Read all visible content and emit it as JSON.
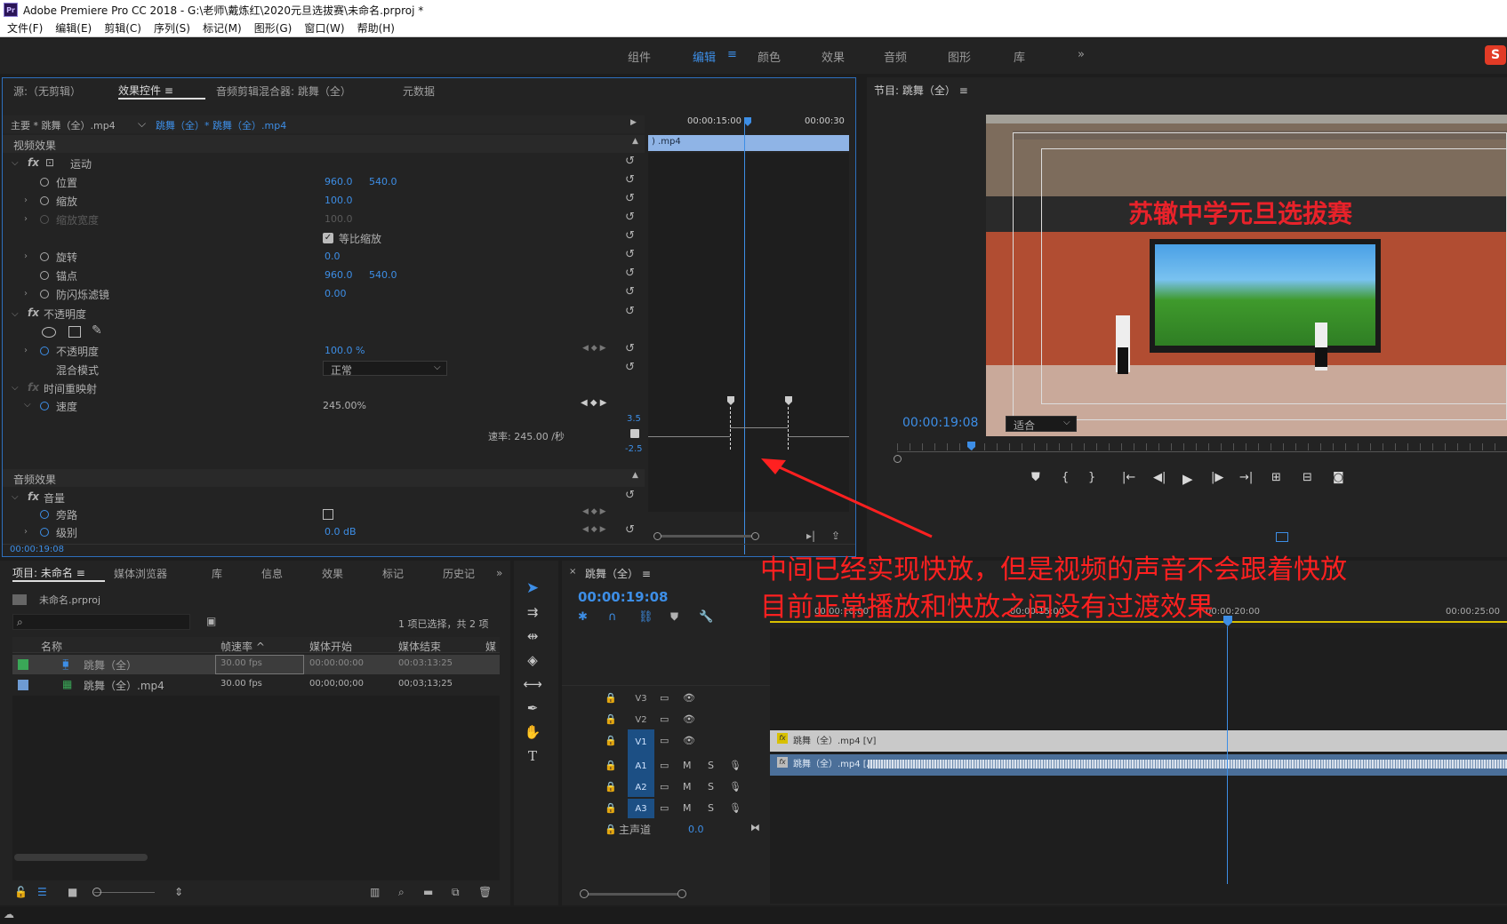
{
  "window": {
    "title": "Adobe Premiere Pro CC 2018 - G:\\老师\\戴炼红\\2020元旦选拔赛\\未命名.prproj *",
    "logo": "Pr"
  },
  "menu": [
    "文件(F)",
    "编辑(E)",
    "剪辑(C)",
    "序列(S)",
    "标记(M)",
    "图形(G)",
    "窗口(W)",
    "帮助(H)"
  ],
  "workspaces": [
    "组件",
    "编辑",
    "颜色",
    "效果",
    "音频",
    "图形",
    "库"
  ],
  "workspace_active": "编辑",
  "effect_panel": {
    "tabs": [
      "源:（无剪辑）",
      "效果控件",
      "音频剪辑混合器: 跳舞（全）",
      "元数据"
    ],
    "master_label": "主要 * 跳舞（全）.mp4",
    "clip_label": "跳舞（全）* 跳舞（全）.mp4",
    "ruler_time1": "00:00:15:00",
    "ruler_time2": "00:00:30",
    "clip_bar": ") .mp4",
    "video_effects": "视频效果",
    "motion": "运动",
    "position": "位置",
    "position_x": "960.0",
    "position_y": "540.0",
    "scale": "缩放",
    "scale_val": "100.0",
    "scale_width": "缩放宽度",
    "scale_width_val": "100.0",
    "uniform_scale": "等比缩放",
    "rotation": "旋转",
    "rotation_val": "0.0",
    "anchor": "锚点",
    "anchor_x": "960.0",
    "anchor_y": "540.0",
    "anti_flicker": "防闪烁滤镜",
    "anti_flicker_val": "0.00",
    "opacity_group": "不透明度",
    "opacity": "不透明度",
    "opacity_val": "100.0 %",
    "blend_mode": "混合模式",
    "blend_val": "正常",
    "time_remap": "时间重映射",
    "speed": "速度",
    "speed_val": "245.00%",
    "speed_max": "3.5",
    "speed_min": "-2.5",
    "rate_label": "速率: 245.00 /秒",
    "audio_effects": "音频效果",
    "volume": "音量",
    "bypass": "旁路",
    "level": "级别",
    "level_val": "0.0 dB",
    "timecode": "00:00:19:08"
  },
  "program": {
    "title": "节目: 跳舞（全）",
    "timecode": "00:00:19:08",
    "fit": "适合",
    "banner": "苏辙中学元旦选拔赛"
  },
  "project": {
    "tabs": [
      "项目: 未命名",
      "媒体浏览器",
      "库",
      "信息",
      "效果",
      "标记",
      "历史记"
    ],
    "file": "未命名.prproj",
    "selection": "1 项已选择，共 2 项",
    "columns": [
      "名称",
      "帧速率",
      "媒体开始",
      "媒体结束",
      "媒"
    ],
    "rows": [
      {
        "name": "跳舞（全）",
        "fps": "30.00 fps",
        "start": "00:00:00:00",
        "end": "00:03:13:25",
        "color": "#3aa757"
      },
      {
        "name": "跳舞（全）.mp4",
        "fps": "30.00 fps",
        "start": "00;00;00;00",
        "end": "00;03;13;25",
        "color": "#6e9bd3"
      }
    ]
  },
  "timeline": {
    "title": "跳舞（全）",
    "timecode": "00:00:19:08",
    "ruler": [
      "00:00:10:00",
      "00:00:15:00",
      "00:00:20:00",
      "00:00:25:00"
    ],
    "tracks_video": [
      "V3",
      "V2",
      "V1"
    ],
    "tracks_audio": [
      "A1",
      "A2",
      "A3"
    ],
    "master": "主声道",
    "master_val": "0.0",
    "clip_video": "跳舞（全）.mp4 [V]",
    "clip_audio": "跳舞（全）.mp4 [A]",
    "m_label": "M",
    "s_label": "S"
  },
  "annotation": {
    "line1": "中间已经实现快放，但是视频的声音不会跟着快放",
    "line2": "目前正常播放和快放之间没有过渡效果"
  },
  "colors": {
    "accent": "#3d8ee6",
    "annotation": "#ff2020",
    "clip_bar": "#8fb4e6"
  }
}
